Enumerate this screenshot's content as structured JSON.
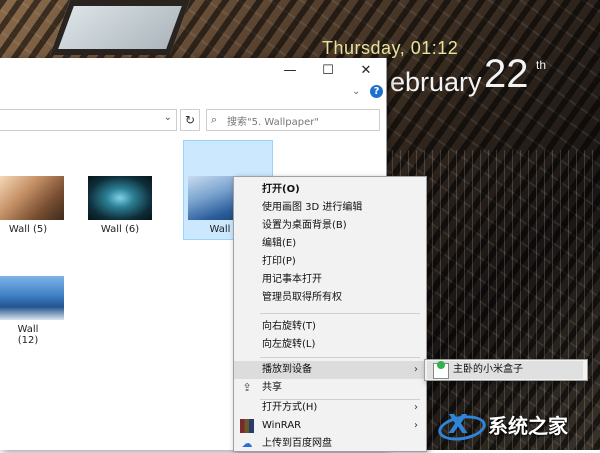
{
  "desktop": {
    "clock": {
      "day_time": "Thursday, 01:12",
      "month": "ebruary",
      "date": "22",
      "suffix": "th"
    }
  },
  "window": {
    "controls": {
      "minimize": "—",
      "maximize": "☐",
      "close": "✕"
    },
    "help": "?",
    "expand": "⌄",
    "address_dropdown": "⌄",
    "refresh": "↻",
    "search": {
      "placeholder": "搜索\"5. Wallpaper\""
    },
    "files": [
      {
        "label": "Wall (5)"
      },
      {
        "label": "Wall (6)"
      },
      {
        "label": "Wall"
      },
      {
        "label": "Wall (12)"
      }
    ]
  },
  "context_menu": {
    "items": [
      {
        "label": "打开(O)"
      },
      {
        "label": "使用画图 3D 进行编辑"
      },
      {
        "label": "设置为桌面背景(B)"
      },
      {
        "label": "编辑(E)"
      },
      {
        "label": "打印(P)"
      },
      {
        "label": "用记事本打开"
      },
      {
        "label": "管理员取得所有权"
      },
      {
        "label": "向右旋转(T)"
      },
      {
        "label": "向左旋转(L)"
      },
      {
        "label": "播放到设备"
      },
      {
        "label": "共享"
      },
      {
        "label": "打开方式(H)"
      },
      {
        "label": "WinRAR"
      },
      {
        "label": "上传到百度网盘"
      }
    ],
    "submenu_arrow": "›"
  },
  "submenu": {
    "items": [
      {
        "label": "主卧的小米盒子"
      }
    ]
  },
  "watermark": {
    "text": "系统之家"
  },
  "colors": {
    "accent": "#1f6fd1",
    "selection": "#cce8ff",
    "menu_bg": "#f2f2f2"
  }
}
